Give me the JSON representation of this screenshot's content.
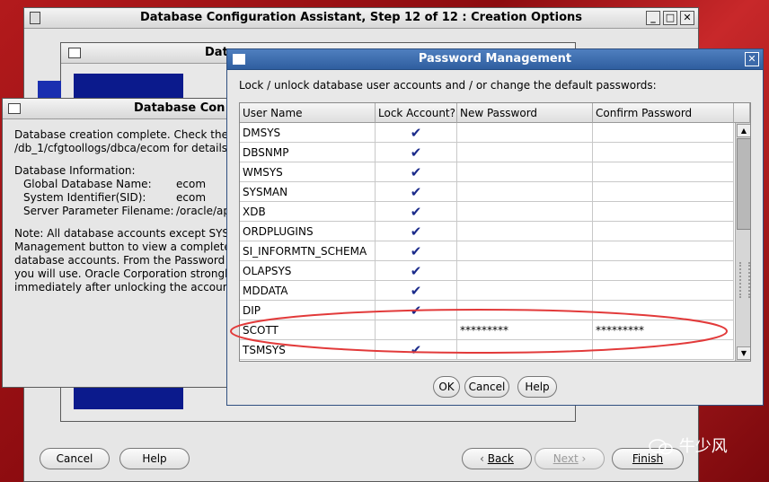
{
  "main_window": {
    "title": "Database Configuration Assistant, Step 12 of 12 : Creation Options",
    "buttons": {
      "cancel": "Cancel",
      "help": "Help",
      "back": "Back",
      "next": "Next",
      "finish": "Finish"
    }
  },
  "mid_window": {
    "title_partial": "Dat"
  },
  "complete_dialog": {
    "title": "Database Con",
    "line1": "Database creation complete. Check the lo",
    "line2": "/db_1/cfgtoollogs/dbca/ecom for details.",
    "info_header": "Database Information:",
    "global_db_label": "Global Database Name:",
    "global_db_value": "ecom",
    "sid_label": "System Identifier(SID):",
    "sid_value": "ecom",
    "spfile_label": "Server Parameter Filename:",
    "spfile_value": "/oracle/ap",
    "note1": "Note: All database accounts except SYS a",
    "note2": "Management button to view a complete li",
    "note3": "database accounts. From the Password M",
    "note4": "you will use. Oracle Corporation strongly",
    "note5": "immediately after unlocking the account."
  },
  "password_dialog": {
    "title": "Password Management",
    "instruction": "Lock / unlock database user accounts and / or change the default passwords:",
    "columns": [
      "User Name",
      "Lock Account?",
      "New Password",
      "Confirm Password"
    ],
    "rows": [
      {
        "user": "DMSYS",
        "locked": "✔",
        "new_pw": "",
        "confirm_pw": ""
      },
      {
        "user": "DBSNMP",
        "locked": "✔",
        "new_pw": "",
        "confirm_pw": ""
      },
      {
        "user": "WMSYS",
        "locked": "✔",
        "new_pw": "",
        "confirm_pw": ""
      },
      {
        "user": "SYSMAN",
        "locked": "✔",
        "new_pw": "",
        "confirm_pw": ""
      },
      {
        "user": "XDB",
        "locked": "✔",
        "new_pw": "",
        "confirm_pw": ""
      },
      {
        "user": "ORDPLUGINS",
        "locked": "✔",
        "new_pw": "",
        "confirm_pw": ""
      },
      {
        "user": "SI_INFORMTN_SCHEMA",
        "locked": "✔",
        "new_pw": "",
        "confirm_pw": ""
      },
      {
        "user": "OLAPSYS",
        "locked": "✔",
        "new_pw": "",
        "confirm_pw": ""
      },
      {
        "user": "MDDATA",
        "locked": "✔",
        "new_pw": "",
        "confirm_pw": ""
      },
      {
        "user": "DIP",
        "locked": "✔",
        "new_pw": "",
        "confirm_pw": ""
      },
      {
        "user": "SCOTT",
        "locked": "",
        "new_pw": "*********",
        "confirm_pw": "*********"
      },
      {
        "user": "TSMSYS",
        "locked": "✔",
        "new_pw": "",
        "confirm_pw": ""
      }
    ],
    "buttons": {
      "ok": "OK",
      "cancel": "Cancel",
      "help": "Help"
    }
  },
  "watermark": {
    "text": "牛少风"
  },
  "colors": {
    "highlight_ellipse": "#e23a3a",
    "check": "#1a2a8a",
    "title_blue": "#2f5e9f"
  }
}
